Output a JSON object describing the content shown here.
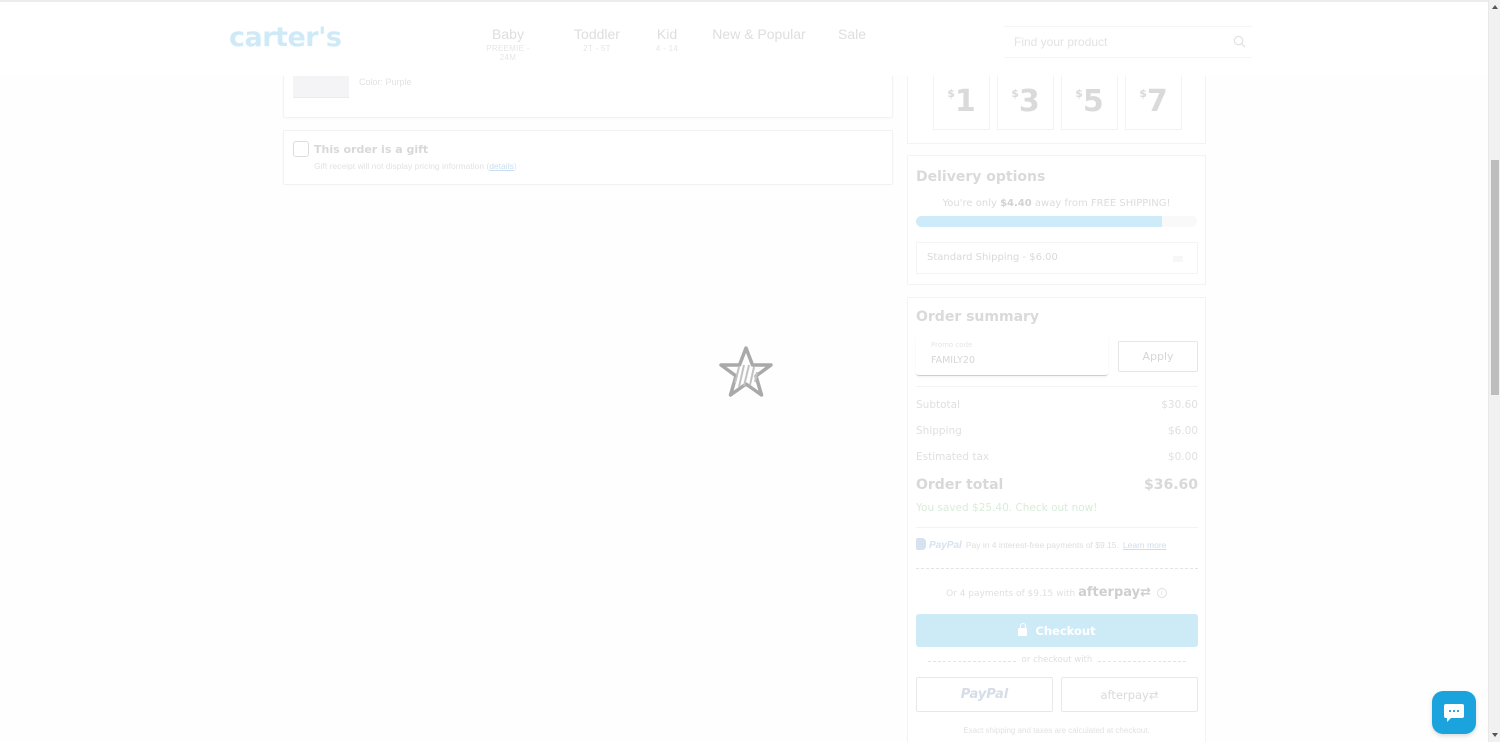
{
  "header": {
    "logo": "carter's",
    "nav": [
      {
        "label": "Baby",
        "sub": "PREEMIE - 24M"
      },
      {
        "label": "Toddler",
        "sub": "2T - 5T"
      },
      {
        "label": "Kid",
        "sub": "4 - 14"
      },
      {
        "label": "New & Popular",
        "sub": ""
      },
      {
        "label": "Sale",
        "sub": ""
      }
    ],
    "search_placeholder": "Find your product"
  },
  "cart": {
    "product": {
      "color_label": "Color: Purple"
    },
    "gift": {
      "title": "This order is a gift",
      "desc_prefix": "Gift receipt will not display pricing information (",
      "desc_link": "details",
      "desc_suffix": ")",
      "checked": false
    }
  },
  "donation": {
    "currency": "$",
    "amounts": [
      "1",
      "3",
      "5",
      "7"
    ]
  },
  "delivery": {
    "title": "Delivery options",
    "free_ship_prefix": "You're only ",
    "free_ship_amount": "$4.40",
    "free_ship_suffix": " away from FREE SHIPPING!",
    "progress_fraction": 0.874,
    "selected_option": "Standard Shipping - $6.00"
  },
  "summary": {
    "title": "Order summary",
    "promo_label": "Promo code",
    "promo_value": "FAMILY20",
    "apply_label": "Apply",
    "rows": [
      {
        "label": "Subtotal",
        "value": "$30.60"
      },
      {
        "label": "Shipping",
        "value": "$6.00"
      },
      {
        "label": "Estimated tax",
        "value": "$0.00"
      }
    ],
    "total_label": "Order total",
    "total_value": "$36.60",
    "saved_text": "You saved $25.40. Check out now!",
    "paypal_brand": "PayPal",
    "paypal_text": "Pay in 4 interest-free payments of $9.15.",
    "paypal_link": "Learn more",
    "afterpay_text": "Or 4 payments of $9.15 with",
    "afterpay_brand": "afterpay",
    "checkout_label": "Checkout",
    "or_text": "or checkout with",
    "alt_paypal": "PayPal",
    "alt_afterpay": "afterpay",
    "disclaimer": "Exact shipping and taxes are calculated at checkout."
  },
  "colors": {
    "brand_blue": "#1aa3dc",
    "checkout_disabled": "#cdebf7",
    "progress_fill": "#cdebf8"
  }
}
